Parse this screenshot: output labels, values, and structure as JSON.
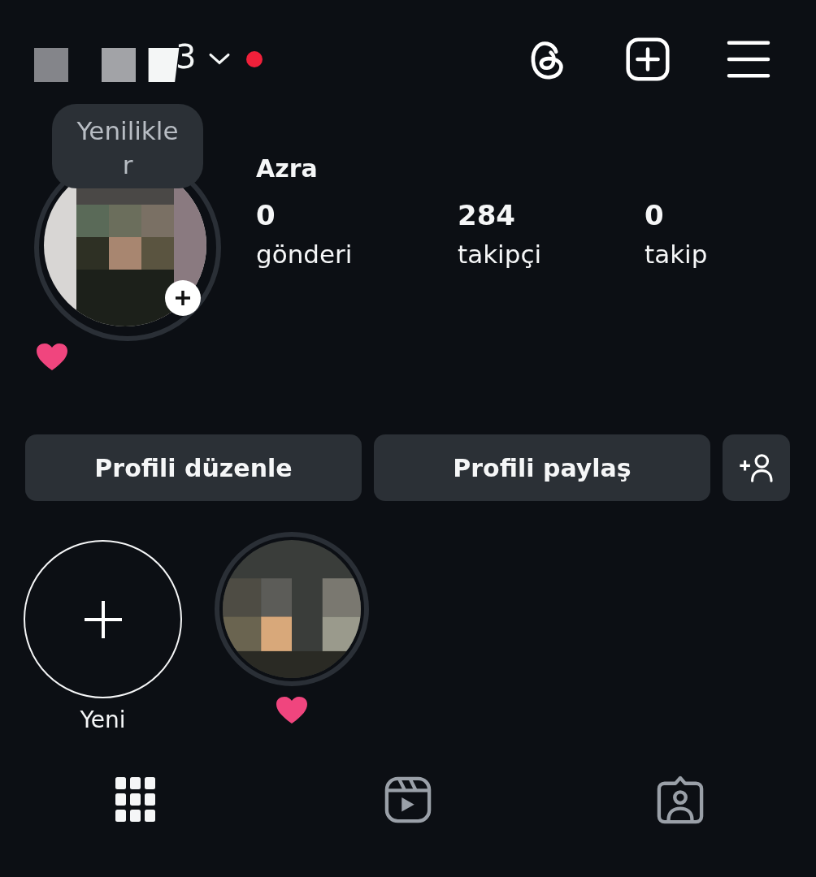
{
  "header": {
    "username_visible": "3",
    "has_notification": true
  },
  "profile": {
    "tooltip": "Yenilikler",
    "name": "Azra",
    "has_story_ring": true
  },
  "stats": [
    {
      "value": "0",
      "label": "gönderi"
    },
    {
      "value": "284",
      "label": "takipçi"
    },
    {
      "value": "0",
      "label": "takip"
    }
  ],
  "actions": [
    {
      "kind": "text",
      "label": "Profili düzenle"
    },
    {
      "kind": "text",
      "label": "Profili paylaş"
    },
    {
      "kind": "icon"
    }
  ],
  "highlights": [
    {
      "kind": "new",
      "label": "Yeni"
    },
    {
      "kind": "picture"
    }
  ],
  "tabs": [
    {
      "kind": "grid",
      "selected": true
    },
    {
      "kind": "reels",
      "selected": false
    },
    {
      "kind": "tagged",
      "selected": false
    }
  ]
}
